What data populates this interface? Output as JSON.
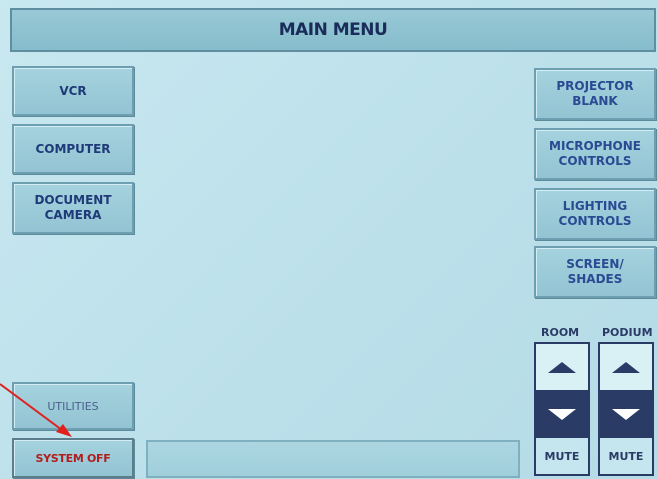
{
  "header": {
    "title": "MAIN MENU"
  },
  "sources": [
    {
      "label": "VCR"
    },
    {
      "label": "COMPUTER"
    },
    {
      "label": "DOCUMENT\nCAMERA"
    }
  ],
  "controls": [
    {
      "label": "PROJECTOR\nBLANK"
    },
    {
      "label": "MICROPHONE\nCONTROLS"
    },
    {
      "label": "LIGHTING\nCONTROLS"
    },
    {
      "label": "SCREEN/\nSHADES"
    }
  ],
  "utilities_label": "UTILITIES",
  "system_off_label": "SYSTEM OFF",
  "volume": {
    "room": {
      "label": "ROOM",
      "mute_label": "MUTE"
    },
    "podium": {
      "label": "PODIUM",
      "mute_label": "MUTE"
    }
  },
  "colors": {
    "annotation_arrow": "#e0201c",
    "text_primary": "#1e3a78"
  }
}
